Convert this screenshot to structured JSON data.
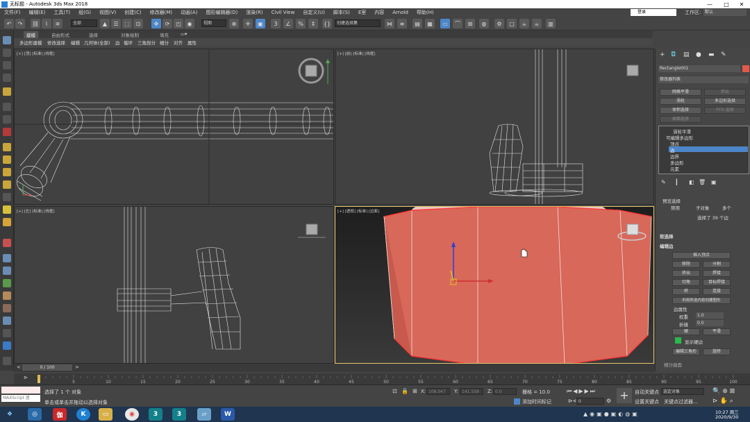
{
  "titlebar": {
    "title": "无标题 - Autodesk 3ds Max 2018",
    "minimize": "—",
    "maximize": "□",
    "close": "✕"
  },
  "menu": [
    "文件(F)",
    "编辑(E)",
    "工具(T)",
    "组(G)",
    "视图(V)",
    "创建(C)",
    "修改器(M)",
    "动画(A)",
    "图形编辑器(D)",
    "渲染(R)",
    "Civil View",
    "自定义(U)",
    "脚本(S)",
    "E室",
    "内容",
    "Arnold",
    "帮助(H)"
  ],
  "account": {
    "login": "登录",
    "workspace_label": "工作区:",
    "workspace_value": "默认"
  },
  "toolbar": {
    "selection_filter": "全部",
    "view_select": "视图",
    "named_selection": "创建选择集"
  },
  "ribbon": {
    "tabs": [
      "建模",
      "自由形式",
      "选择",
      "对象绘制",
      "填充"
    ],
    "active_tab": "建模",
    "sub_items": [
      "多边形建模",
      "修改选择",
      "编辑",
      "几何体(全部)",
      "循环",
      "三角剖分",
      "细分",
      "对齐",
      "属性"
    ],
    "sub_edge": "边"
  },
  "viewports": {
    "top": "[+] [顶] [标准] [线框]",
    "front": "[+] [前] [标准] [线框]",
    "left": "[+] [左] [标准] [线框]",
    "persp": "[+] [透视] [标准] [边面]"
  },
  "cmd": {
    "object_name": "Rectangle001",
    "object_color": "#e05a4a",
    "modifier_list": "修改器列表",
    "buttons": [
      [
        "网格平滑",
        "挤出"
      ],
      [
        "涡轮",
        "多边形选择"
      ],
      [
        "体积选择",
        "FFD 选择"
      ],
      [
        "曲面选择",
        ""
      ]
    ],
    "stack_top": "涡轮平滑",
    "stack_poly": "可编辑多边形",
    "stack_sub": [
      "顶点",
      "边",
      "边界",
      "多边形",
      "元素"
    ],
    "stack_selected": "边",
    "preview_select": "预览选择",
    "preview_options": [
      "禁用",
      "子对象",
      "多个"
    ],
    "selected_count": "选择了 39 个边",
    "soft_select": "软选择",
    "edit_edges": "编辑边",
    "insert_vertex": "插入顶点",
    "edge_btns": [
      [
        "移除",
        "分割"
      ],
      [
        "挤出",
        "焊接"
      ],
      [
        "切角",
        "目标焊接"
      ],
      [
        "桥",
        "连接"
      ]
    ],
    "create_shape": "利用所选内容创建图形",
    "edge_props": "边属性",
    "weight_label": "权重",
    "weight_value": "1.0",
    "crease_label": "折缝",
    "crease_value": "0.0",
    "hard": "硬",
    "smooth": "平滑",
    "show_hard": "显示硬边",
    "edit_tri": "编辑三角形",
    "turn": "旋转",
    "more": "细分曲面"
  },
  "time": {
    "slider": "0 / 100",
    "ticks": [
      "0",
      "5",
      "10",
      "15",
      "20",
      "25",
      "30",
      "35",
      "40",
      "45",
      "50",
      "55",
      "60",
      "65",
      "70",
      "75",
      "80",
      "85",
      "90",
      "95",
      "100"
    ]
  },
  "status": {
    "maxscript": "MAXScript 迷",
    "line1": "选择了 1 个 对象",
    "line2": "单击或单击并拖动以选择对象",
    "x_label": "X:",
    "x_value": "108.047",
    "y_label": "Y:",
    "y_value": "141.558",
    "z_label": "Z:",
    "z_value": "0.0",
    "grid": "栅格 = 10.0",
    "add_time_tag": "添加时间标记",
    "auto_key": "自动关键点",
    "set_key": "设置关键点",
    "key_filter": "选定对象",
    "key_filters_btn": "关键点过滤器...",
    "frame": "0"
  },
  "taskbar": {
    "time": "10:27 周三",
    "date": "2020/9/30",
    "apps": [
      "start",
      "baidu",
      "kuwo",
      "explorer",
      "chrome",
      "3dsmax1",
      "3dsmax2",
      "app",
      "word"
    ]
  }
}
